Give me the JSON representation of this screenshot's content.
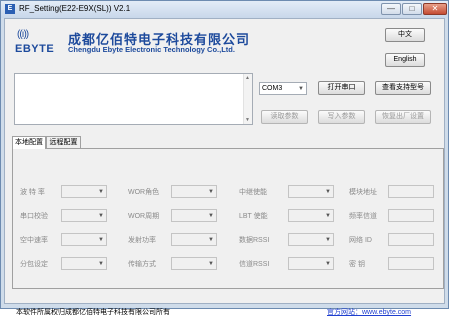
{
  "window": {
    "title": "RF_Setting(E22-E9X(SL)) V2.1",
    "app_icon": "E",
    "controls": {
      "minimize": "—",
      "maximize": "□",
      "close": "✕"
    }
  },
  "brand": {
    "logo_waves": "((ı))",
    "logo_text": "EBYTE",
    "company_cn": "成都亿佰特电子科技有限公司",
    "company_en": "Chengdu Ebyte Electronic Technology Co.,Ltd."
  },
  "lang": {
    "chinese": "中文",
    "english": "English"
  },
  "port": {
    "value": "COM3",
    "open_label": "打开串口",
    "models_label": "查看支持型号"
  },
  "params": {
    "read_label": "读取参数",
    "write_label": "写入参数",
    "reset_label": "恢复出厂设置"
  },
  "tabs": [
    {
      "label": "本地配置"
    },
    {
      "label": "远程配置"
    }
  ],
  "fields": {
    "baud": "波 特 率",
    "parity": "串口校验",
    "air_rate": "空中速率",
    "packet": "分包设定",
    "wor_role": "WOR角色",
    "wor_period": "WOR周期",
    "tx_power": "发射功率",
    "tx_mode": "传输方式",
    "relay": "中继使能",
    "lbt": "LBT 使能",
    "data_rssi": "数据RSSI",
    "channel_rssi": "信道RSSI",
    "address": "模块地址",
    "freq": "频率信道",
    "net_id": "网络 ID",
    "key": "密 钥"
  },
  "footer": {
    "copyright": "本软件所属权归成都亿佰特电子科技有限公司所有",
    "website": "官方网站：www.ebyte.com"
  },
  "colors": {
    "brand": "#1d4a9c",
    "link": "#1f3fcf"
  }
}
